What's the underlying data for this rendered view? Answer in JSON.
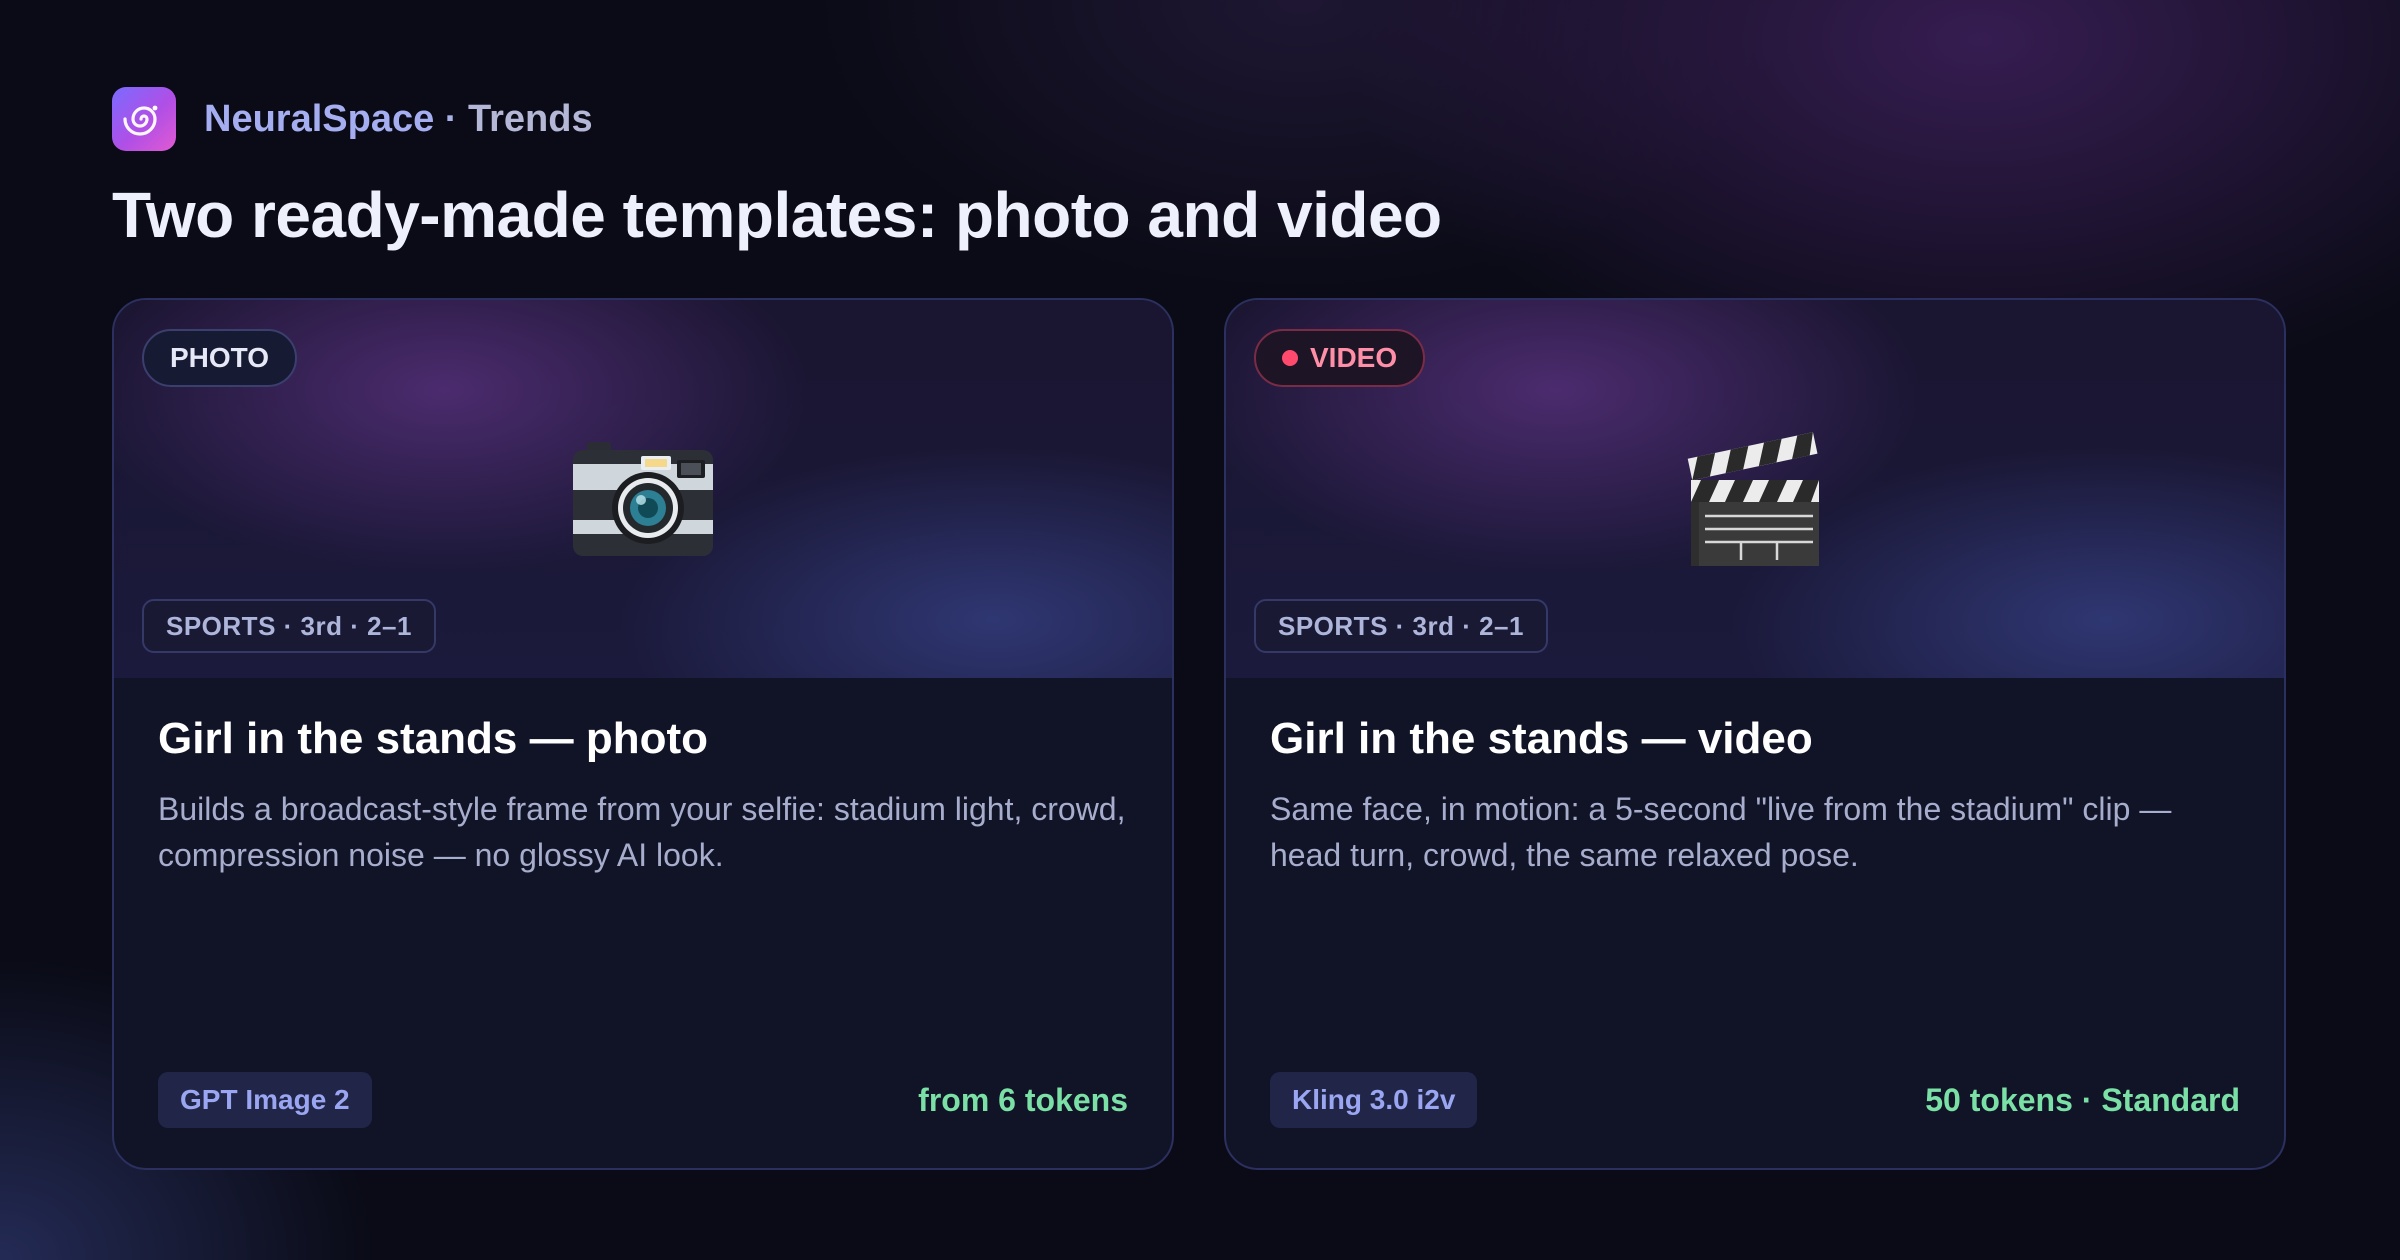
{
  "header": {
    "brand_name": "NeuralSpace",
    "separator": "·",
    "section": "Trends",
    "title": "Two ready-made templates: photo and video"
  },
  "cards": [
    {
      "type_label": "PHOTO",
      "icon": "camera-icon",
      "meta": "SPORTS · 3rd · 2–1",
      "title": "Girl in the stands — photo",
      "description": "Builds a broadcast-style frame from your selfie: stadium light, crowd, compression noise — no glossy AI look.",
      "model": "GPT Image 2",
      "price": "from 6 tokens"
    },
    {
      "type_label": "VIDEO",
      "icon": "clapperboard-icon",
      "meta": "SPORTS · 3rd · 2–1",
      "title": "Girl in the stands — video",
      "description": "Same face, in motion: a 5-second \"live from the stadium\" clip — head turn, crowd, the same relaxed pose.",
      "model": "Kling 3.0 i2v",
      "price": "50 tokens · Standard"
    }
  ],
  "colors": {
    "background": "#0a0b16",
    "brand_text": "#a6aef2",
    "price_green": "#7ae0a6",
    "video_accent": "#ff4a6e",
    "model_chip_text": "#9aa6f2"
  }
}
